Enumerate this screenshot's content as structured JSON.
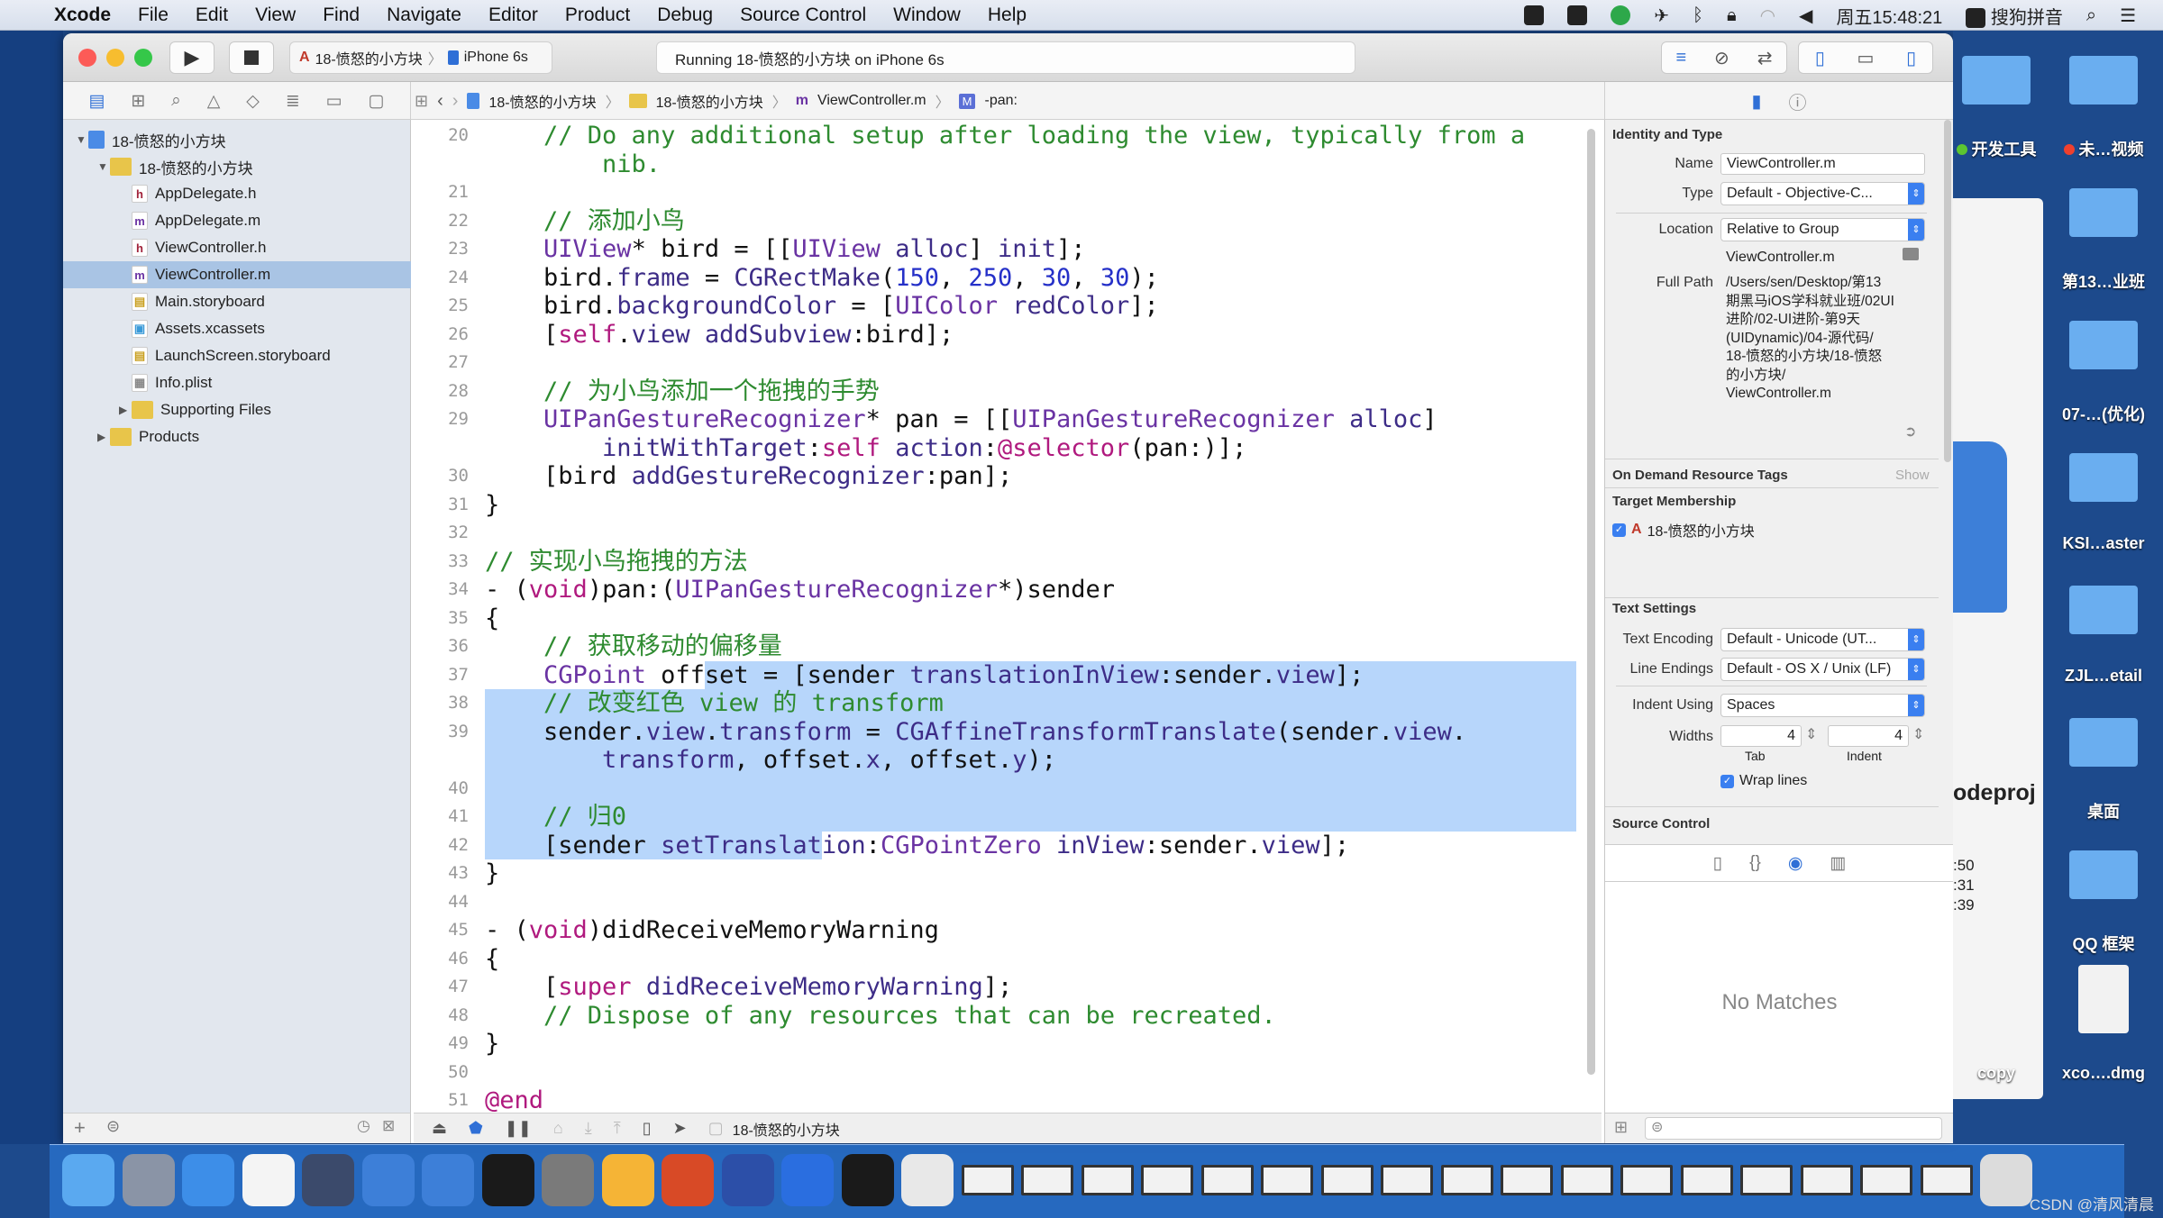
{
  "menubar": {
    "apple_icon": "apple-logo-icon",
    "items": [
      "Xcode",
      "File",
      "Edit",
      "View",
      "Find",
      "Navigate",
      "Editor",
      "Product",
      "Debug",
      "Source Control",
      "Window",
      "Help"
    ],
    "clock": "周五15:48:21",
    "input_method": "搜狗拼音"
  },
  "toolbar": {
    "scheme": "18-愤怒的小方块",
    "device": "iPhone 6s",
    "status": "Running 18-愤怒的小方块 on iPhone 6s"
  },
  "jumpbar": [
    "18-愤怒的小方块",
    "18-愤怒的小方块",
    "ViewController.m",
    "-pan:"
  ],
  "navigator": {
    "items": [
      {
        "label": "18-愤怒的小方块",
        "kind": "project",
        "level": 0,
        "expanded": true
      },
      {
        "label": "18-愤怒的小方块",
        "kind": "folder",
        "level": 1,
        "expanded": true
      },
      {
        "label": "AppDelegate.h",
        "kind": "h",
        "level": 2
      },
      {
        "label": "AppDelegate.m",
        "kind": "m",
        "level": 2
      },
      {
        "label": "ViewController.h",
        "kind": "h",
        "level": 2
      },
      {
        "label": "ViewController.m",
        "kind": "m",
        "level": 2,
        "selected": true
      },
      {
        "label": "Main.storyboard",
        "kind": "storyboard",
        "level": 2
      },
      {
        "label": "Assets.xcassets",
        "kind": "assets",
        "level": 2
      },
      {
        "label": "LaunchScreen.storyboard",
        "kind": "storyboard",
        "level": 2
      },
      {
        "label": "Info.plist",
        "kind": "plist",
        "level": 2
      },
      {
        "label": "Supporting Files",
        "kind": "folder",
        "level": 2,
        "expanded": false
      },
      {
        "label": "Products",
        "kind": "folder",
        "level": 1,
        "expanded": false
      }
    ]
  },
  "editor": {
    "rows": [
      {
        "n": "20",
        "t": [
          [
            "c",
            "    // Do any additional setup after loading the view, typically from a"
          ]
        ]
      },
      {
        "n": "",
        "t": [
          [
            "c",
            "        nib."
          ]
        ]
      },
      {
        "n": "21",
        "t": []
      },
      {
        "n": "22",
        "t": [
          [
            "c",
            "    // 添加小鸟"
          ]
        ]
      },
      {
        "n": "23",
        "t": [
          [
            "p",
            "    "
          ],
          [
            "t",
            "UIView"
          ],
          [
            "p",
            "* bird = [["
          ],
          [
            "t",
            "UIView"
          ],
          [
            "p",
            " "
          ],
          [
            "m",
            "alloc"
          ],
          [
            "p",
            "] "
          ],
          [
            "m",
            "init"
          ],
          [
            "p",
            "];"
          ]
        ]
      },
      {
        "n": "24",
        "t": [
          [
            "p",
            "    bird."
          ],
          [
            "m",
            "frame"
          ],
          [
            "p",
            " = "
          ],
          [
            "m",
            "CGRectMake"
          ],
          [
            "p",
            "("
          ],
          [
            "n",
            "150"
          ],
          [
            "p",
            ", "
          ],
          [
            "n",
            "250"
          ],
          [
            "p",
            ", "
          ],
          [
            "n",
            "30"
          ],
          [
            "p",
            ", "
          ],
          [
            "n",
            "30"
          ],
          [
            "p",
            ");"
          ]
        ]
      },
      {
        "n": "25",
        "t": [
          [
            "p",
            "    bird."
          ],
          [
            "m",
            "backgroundColor"
          ],
          [
            "p",
            " = ["
          ],
          [
            "t",
            "UIColor"
          ],
          [
            "p",
            " "
          ],
          [
            "m",
            "redColor"
          ],
          [
            "p",
            "];"
          ]
        ]
      },
      {
        "n": "26",
        "t": [
          [
            "p",
            "    ["
          ],
          [
            "k",
            "self"
          ],
          [
            "p",
            "."
          ],
          [
            "m",
            "view"
          ],
          [
            "p",
            " "
          ],
          [
            "m",
            "addSubview"
          ],
          [
            "p",
            ":bird];"
          ]
        ]
      },
      {
        "n": "27",
        "t": []
      },
      {
        "n": "28",
        "t": [
          [
            "c",
            "    // 为小鸟添加一个拖拽的手势"
          ]
        ]
      },
      {
        "n": "29",
        "t": [
          [
            "p",
            "    "
          ],
          [
            "t",
            "UIPanGestureRecognizer"
          ],
          [
            "p",
            "* pan = [["
          ],
          [
            "t",
            "UIPanGestureRecognizer"
          ],
          [
            "p",
            " "
          ],
          [
            "m",
            "alloc"
          ],
          [
            "p",
            "]"
          ]
        ]
      },
      {
        "n": "",
        "t": [
          [
            "p",
            "        "
          ],
          [
            "m",
            "initWithTarget"
          ],
          [
            "p",
            ":"
          ],
          [
            "k",
            "self"
          ],
          [
            "p",
            " "
          ],
          [
            "m",
            "action"
          ],
          [
            "p",
            ":"
          ],
          [
            "k",
            "@selector"
          ],
          [
            "p",
            "(pan:)];"
          ]
        ]
      },
      {
        "n": "30",
        "t": [
          [
            "p",
            "    [bird "
          ],
          [
            "m",
            "addGestureRecognizer"
          ],
          [
            "p",
            ":pan];"
          ]
        ]
      },
      {
        "n": "31",
        "t": [
          [
            "p",
            "}"
          ]
        ]
      },
      {
        "n": "32",
        "t": []
      },
      {
        "n": "33",
        "t": [
          [
            "c",
            "// 实现小鸟拖拽的方法"
          ]
        ]
      },
      {
        "n": "34",
        "t": [
          [
            "p",
            "- ("
          ],
          [
            "k",
            "void"
          ],
          [
            "p",
            ")pan:("
          ],
          [
            "t",
            "UIPanGestureRecognizer"
          ],
          [
            "p",
            "*)sender"
          ]
        ]
      },
      {
        "n": "35",
        "t": [
          [
            "p",
            "{"
          ]
        ]
      },
      {
        "n": "36",
        "t": [
          [
            "c",
            "    // 获取移动的偏移量"
          ]
        ]
      },
      {
        "n": "37",
        "e": 1,
        "t": [
          [
            "p",
            "    "
          ],
          [
            "t",
            "CGPoint"
          ],
          [
            "p",
            " off"
          ],
          [
            "p",
            "set = [sender ",
            1
          ],
          [
            "m",
            "translationInView",
            1
          ],
          [
            "p",
            ":sender.",
            1
          ],
          [
            "m",
            "view",
            1
          ],
          [
            "p",
            "];",
            1
          ]
        ]
      },
      {
        "n": "38",
        "e": 1,
        "t": [
          [
            "c",
            "    // 改变红色 view 的 transform",
            1
          ]
        ]
      },
      {
        "n": "39",
        "e": 1,
        "t": [
          [
            "p",
            "    sender.",
            1
          ],
          [
            "m",
            "view",
            1
          ],
          [
            "p",
            ".",
            1
          ],
          [
            "m",
            "transform",
            1
          ],
          [
            "p",
            " = ",
            1
          ],
          [
            "m",
            "CGAffineTransformTranslate",
            1
          ],
          [
            "p",
            "(sender.",
            1
          ],
          [
            "m",
            "view",
            1
          ],
          [
            "p",
            ".",
            1
          ]
        ]
      },
      {
        "n": "",
        "e": 1,
        "t": [
          [
            "p",
            "        ",
            1
          ],
          [
            "m",
            "transform",
            1
          ],
          [
            "p",
            ", offset.",
            1
          ],
          [
            "m",
            "x",
            1
          ],
          [
            "p",
            ", offset.",
            1
          ],
          [
            "m",
            "y",
            1
          ],
          [
            "p",
            ");",
            1
          ]
        ]
      },
      {
        "n": "40",
        "e": 1,
        "t": []
      },
      {
        "n": "41",
        "e": 1,
        "t": [
          [
            "c",
            "    // 归0",
            1
          ]
        ]
      },
      {
        "n": "42",
        "t": [
          [
            "p",
            "    [sender ",
            1
          ],
          [
            "m",
            "setTranslat",
            1
          ],
          [
            "m",
            "ion"
          ],
          [
            "p",
            ":"
          ],
          [
            "t",
            "CGPointZero"
          ],
          [
            "p",
            " "
          ],
          [
            "m",
            "inView"
          ],
          [
            "p",
            ":sender."
          ],
          [
            "m",
            "view"
          ],
          [
            "p",
            "];"
          ]
        ]
      },
      {
        "n": "43",
        "t": [
          [
            "p",
            "}"
          ]
        ]
      },
      {
        "n": "44",
        "t": []
      },
      {
        "n": "45",
        "t": [
          [
            "p",
            "- ("
          ],
          [
            "k",
            "void"
          ],
          [
            "p",
            ")didReceiveMemoryWarning"
          ]
        ]
      },
      {
        "n": "46",
        "t": [
          [
            "p",
            "{"
          ]
        ]
      },
      {
        "n": "47",
        "t": [
          [
            "p",
            "    ["
          ],
          [
            "k",
            "super"
          ],
          [
            "p",
            " "
          ],
          [
            "m",
            "didReceiveMemoryWarning"
          ],
          [
            "p",
            "];"
          ]
        ]
      },
      {
        "n": "48",
        "t": [
          [
            "c",
            "    // Dispose of any resources that can be recreated."
          ]
        ]
      },
      {
        "n": "49",
        "t": [
          [
            "p",
            "}"
          ]
        ]
      },
      {
        "n": "50",
        "t": []
      },
      {
        "n": "51",
        "t": [
          [
            "k",
            "@end"
          ]
        ]
      }
    ]
  },
  "debugbar": {
    "target": "18-愤怒的小方块"
  },
  "inspector": {
    "identity_title": "Identity and Type",
    "name_label": "Name",
    "name_value": "ViewController.m",
    "type_label": "Type",
    "type_value": "Default - Objective-C...",
    "location_label": "Location",
    "location_value": "Relative to Group",
    "location_file": "ViewController.m",
    "fullpath_label": "Full Path",
    "fullpath_lines": [
      "/Users/sen/Desktop/第13",
      "期黑马iOS学科就业班/02UI",
      "进阶/02-UI进阶-第9天",
      "(UIDynamic)/04-源代码/",
      "18-愤怒的小方块/18-愤怒",
      "的小方块/",
      "ViewController.m"
    ],
    "odr_title": "On Demand Resource Tags",
    "odr_show": "Show",
    "target_title": "Target Membership",
    "target_item": "18-愤怒的小方块",
    "target_checked": true,
    "text_title": "Text Settings",
    "encoding_label": "Text Encoding",
    "encoding_value": "Default - Unicode (UT...",
    "endings_label": "Line Endings",
    "endings_value": "Default - OS X / Unix (LF)",
    "indent_label": "Indent Using",
    "indent_value": "Spaces",
    "widths_label": "Widths",
    "tab_value": "4",
    "indent_width_value": "4",
    "tab_label": "Tab",
    "indent_sub_label": "Indent",
    "wrap_label": "Wrap lines",
    "wrap_checked": true,
    "sc_title": "Source Control",
    "no_matches": "No Matches"
  },
  "desktop": {
    "items": [
      {
        "label": "开发工具",
        "col": 0,
        "row": 0,
        "tag": "#5cc531"
      },
      {
        "label": "未…视频",
        "col": 1,
        "row": 0,
        "tag": "#f0402e"
      },
      {
        "label": "第13…业班",
        "col": 1,
        "row": 1
      },
      {
        "label": "07-…(优化)",
        "col": 1,
        "row": 2
      },
      {
        "label": "KSI…aster",
        "col": 1,
        "row": 3
      },
      {
        "label": "ZJL…etail",
        "col": 1,
        "row": 4
      },
      {
        "label": "桌面",
        "col": 1,
        "row": 5
      },
      {
        "label": "QQ 框架",
        "col": 1,
        "row": 6
      },
      {
        "label": "xco….dmg",
        "col": 1,
        "row": 7,
        "file": true
      },
      {
        "label": "copy",
        "col": 0,
        "row": 7,
        "bare": true
      }
    ],
    "finder_partial": {
      "title": "odeproj",
      "times": [
        ":50",
        ":31",
        ":39"
      ]
    }
  },
  "dock": [
    "finder",
    "launchpad",
    "safari",
    "mouse",
    "imovie",
    "xcode",
    "simulator",
    "terminal",
    "system-preferences",
    "sketch",
    "powerpoint",
    "quicktime",
    "teamviewer",
    "console",
    "media-player",
    "window-1",
    "window-2",
    "window-3",
    "window-4",
    "window-5",
    "window-6",
    "window-7",
    "window-8",
    "window-9",
    "window-10",
    "window-11",
    "window-12",
    "window-13",
    "window-14",
    "window-15",
    "window-16",
    "window-17",
    "trash"
  ],
  "watermark": "CSDN @清风清晨",
  "colors": {
    "selection": "#b7d6fb",
    "accent": "#3a7ff0",
    "comment": "#2e8b30",
    "keyword": "#b0197e",
    "number": "#2530c8"
  }
}
